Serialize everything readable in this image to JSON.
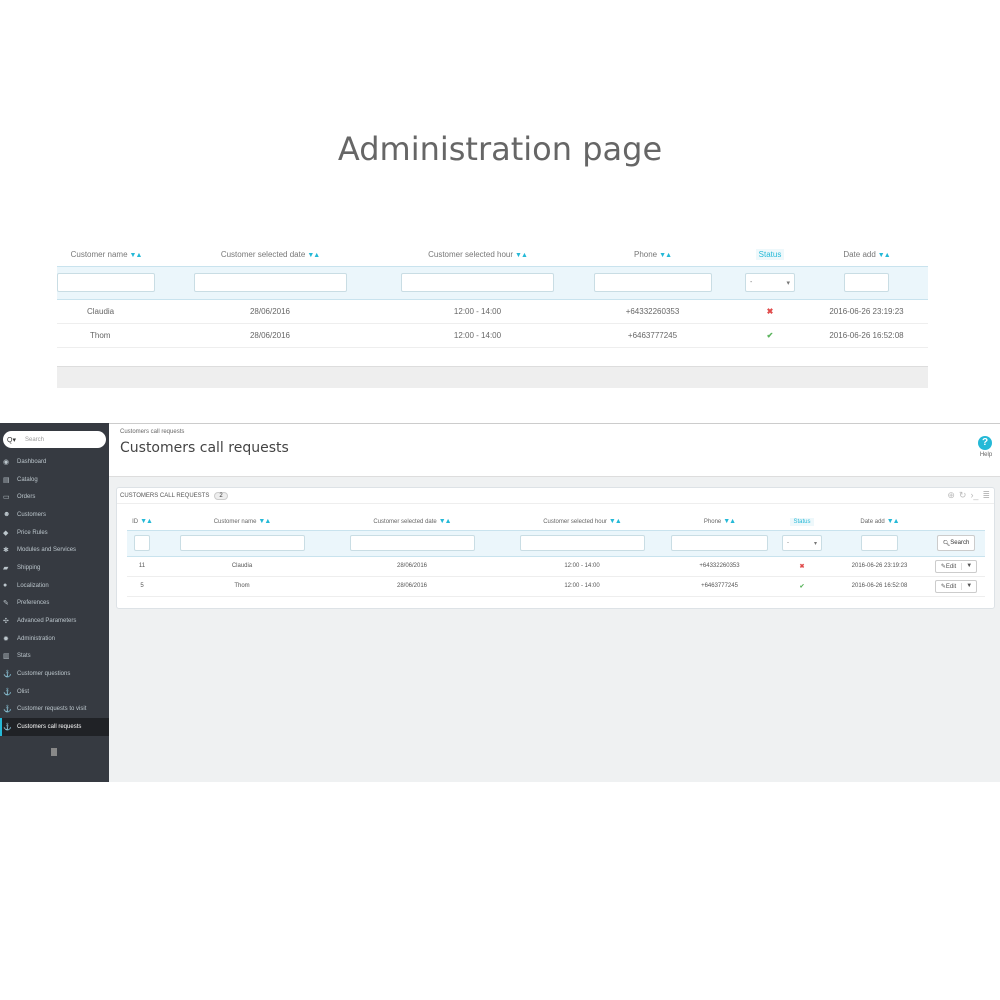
{
  "top": {
    "title": "Administration page",
    "columns": {
      "customer_name": "Customer name",
      "selected_date": "Customer selected date",
      "selected_hour": "Customer selected hour",
      "phone": "Phone",
      "status": "Status",
      "date_add": "Date add"
    },
    "status_filter_value": "-",
    "rows": [
      {
        "name": "Claudia",
        "date": "28/06/2016",
        "hour": "12:00 - 14:00",
        "phone": "+64332260353",
        "status": "no",
        "date_add": "2016-06-26 23:19:23"
      },
      {
        "name": "Thom",
        "date": "28/06/2016",
        "hour": "12:00 - 14:00",
        "phone": "+6463777245",
        "status": "yes",
        "date_add": "2016-06-26 16:52:08"
      }
    ]
  },
  "sort_arrows": "▼▲",
  "admin": {
    "search": {
      "placeholder": "Search",
      "icon_glyph": "Q▾"
    },
    "sidebar": {
      "items": [
        {
          "label": "Dashboard",
          "icon": "dashboard-icon",
          "glyph": "◉"
        },
        {
          "label": "Catalog",
          "icon": "book-icon",
          "glyph": "▤"
        },
        {
          "label": "Orders",
          "icon": "credit-card-icon",
          "glyph": "▭"
        },
        {
          "label": "Customers",
          "icon": "users-icon",
          "glyph": "☻"
        },
        {
          "label": "Price Rules",
          "icon": "tag-icon",
          "glyph": "◆"
        },
        {
          "label": "Modules and Services",
          "icon": "puzzle-icon",
          "glyph": "✱"
        },
        {
          "label": "Shipping",
          "icon": "truck-icon",
          "glyph": "▰"
        },
        {
          "label": "Localization",
          "icon": "globe-icon",
          "glyph": "●"
        },
        {
          "label": "Preferences",
          "icon": "wrench-icon",
          "glyph": "✎"
        },
        {
          "label": "Advanced Parameters",
          "icon": "cogs-icon",
          "glyph": "✣"
        },
        {
          "label": "Administration",
          "icon": "cog-icon",
          "glyph": "✹"
        },
        {
          "label": "Stats",
          "icon": "bar-chart-icon",
          "glyph": "▥"
        },
        {
          "label": "Customer questions",
          "icon": "anchor-icon",
          "glyph": "⚓"
        },
        {
          "label": "Olist",
          "icon": "anchor-icon",
          "glyph": "⚓"
        },
        {
          "label": "Customer requests to visit",
          "icon": "anchor-icon",
          "glyph": "⚓"
        },
        {
          "label": "Customers call requests",
          "icon": "anchor-icon",
          "glyph": "⚓",
          "active": true
        }
      ]
    },
    "breadcrumb": "Customers call requests",
    "page_title": "Customers call requests",
    "help_label": "Help",
    "help_glyph": "?",
    "panel": {
      "title": "CUSTOMERS CALL REQUESTS",
      "count": "2",
      "tools": [
        "⊕",
        "↻",
        "›_",
        "≣"
      ]
    },
    "columns": {
      "id": "ID",
      "customer_name": "Customer name",
      "selected_date": "Customer selected date",
      "selected_hour": "Customer selected hour",
      "phone": "Phone",
      "status": "Status",
      "date_add": "Date add"
    },
    "status_filter_value": "-",
    "search_button": "Search",
    "edit_label": "Edit",
    "rows": [
      {
        "id": "11",
        "name": "Claudia",
        "date": "28/06/2016",
        "hour": "12:00 - 14:00",
        "phone": "+64332260353",
        "status": "no",
        "date_add": "2016-06-26 23:19:23"
      },
      {
        "id": "5",
        "name": "Thom",
        "date": "28/06/2016",
        "hour": "12:00 - 14:00",
        "phone": "+6463777245",
        "status": "yes",
        "date_add": "2016-06-26 16:52:08"
      }
    ]
  },
  "colors": {
    "accent": "#25b9d7",
    "sidebar": "#363a41",
    "status_no": "#e04b4b",
    "status_yes": "#59b35b"
  }
}
